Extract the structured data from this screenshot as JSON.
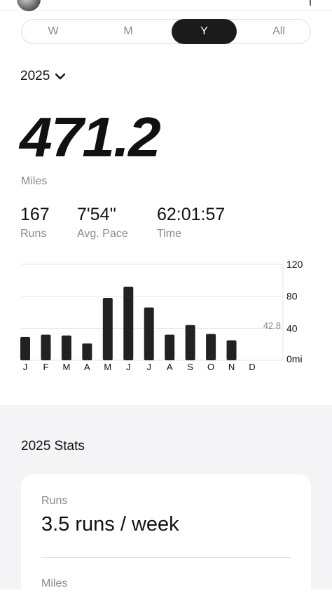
{
  "segments": {
    "items": [
      "W",
      "M",
      "Y",
      "All"
    ],
    "selected": "Y"
  },
  "year_selector": {
    "label": "2025"
  },
  "total": {
    "value": "471.2",
    "unit": "Miles"
  },
  "stats": {
    "runs": {
      "value": "167",
      "label": "Runs"
    },
    "pace": {
      "value": "7'54''",
      "label": "Avg. Pace"
    },
    "time": {
      "value": "62:01:57",
      "label": "Time"
    }
  },
  "chart_data": {
    "type": "bar",
    "categories": [
      "J",
      "F",
      "M",
      "A",
      "M",
      "J",
      "J",
      "A",
      "S",
      "O",
      "N",
      "D"
    ],
    "values": [
      29,
      32,
      31,
      21,
      78,
      92,
      66,
      32,
      44,
      33,
      25,
      0
    ],
    "y_ticks": [
      "120",
      "80",
      "40",
      "0mi"
    ],
    "ylim": [
      0,
      120
    ],
    "average": {
      "value": 42.8,
      "label": "42.8"
    },
    "bar_color": "#222222"
  },
  "stats_section": {
    "title": "2025 Stats",
    "card": {
      "label": "Runs",
      "value": "3.5 runs / week",
      "next_label": "Miles"
    }
  }
}
